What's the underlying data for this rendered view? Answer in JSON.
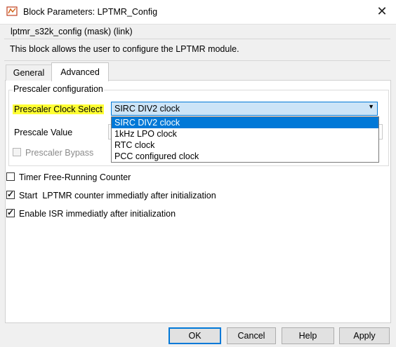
{
  "window": {
    "title": "Block Parameters: LPTMR_Config",
    "close_glyph": "✕"
  },
  "mask": {
    "title": "lptmr_s32k_config (mask) (link)",
    "description": "This block allows the user to configure the LPTMR module."
  },
  "tabs": [
    {
      "label": "General",
      "active": false
    },
    {
      "label": "Advanced",
      "active": true
    }
  ],
  "prescaler_group": {
    "label": "Prescaler configuration",
    "clock_select": {
      "label": "Prescaler Clock Select",
      "value": "SIRC DIV2 clock",
      "options": [
        "SIRC DIV2 clock",
        "1kHz LPO clock",
        "RTC clock",
        "PCC configured clock"
      ],
      "selected_index": 0
    },
    "prescale_value": {
      "label": "Prescale Value"
    },
    "bypass": {
      "label": "Prescaler Bypass",
      "checked": false,
      "enabled": false
    }
  },
  "options": {
    "free_running": {
      "label": "Timer Free-Running Counter",
      "checked": false
    },
    "start_after_init": {
      "label": "Start  LPTMR counter immediatly after initialization",
      "checked": true
    },
    "isr_after_init": {
      "label": "Enable ISR immediatly after initialization",
      "checked": true
    }
  },
  "buttons": {
    "ok": "OK",
    "cancel": "Cancel",
    "help": "Help",
    "apply": "Apply"
  },
  "colors": {
    "highlight": "#ffff33",
    "selection": "#0078d7",
    "select_bg": "#cce4f7"
  }
}
